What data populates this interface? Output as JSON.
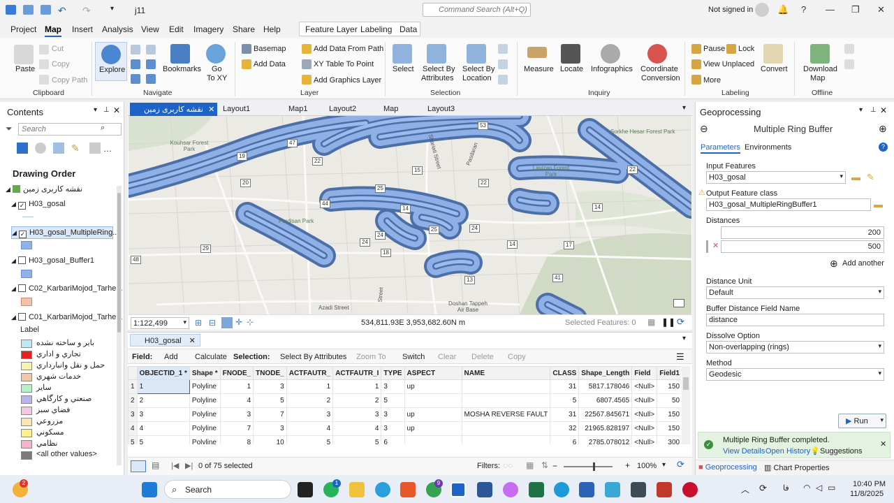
{
  "titlebar": {
    "project": "j11",
    "command_search": "Command Search (Alt+Q)",
    "user": "Not signed in",
    "help": "?"
  },
  "menu": {
    "tabs": [
      "Project",
      "Map",
      "Insert",
      "Analysis",
      "View",
      "Edit",
      "Imagery",
      "Share",
      "Help"
    ],
    "active": "Map",
    "contextual": [
      "Feature Layer",
      "Labeling",
      "Data"
    ]
  },
  "ribbon": {
    "clipboard": {
      "title": "Clipboard",
      "paste": "Paste",
      "cut": "Cut",
      "copy": "Copy",
      "copy_path": "Copy Path"
    },
    "navigate": {
      "title": "Navigate",
      "explore": "Explore",
      "bookmarks": "Bookmarks",
      "goto": "Go",
      "goto2": "To XY"
    },
    "layer": {
      "title": "Layer",
      "basemap": "Basemap",
      "add_data": "Add Data",
      "add_data_from_path": "Add Data From Path",
      "xy_table": "XY Table To Point",
      "add_graphics": "Add Graphics Layer"
    },
    "selection": {
      "title": "Selection",
      "select": "Select",
      "by_attr_1": "Select By",
      "by_attr_2": "Attributes",
      "by_loc_1": "Select By",
      "by_loc_2": "Location"
    },
    "inquiry": {
      "title": "Inquiry",
      "measure": "Measure",
      "locate": "Locate",
      "infographics": "Infographics",
      "coord_1": "Coordinate",
      "coord_2": "Conversion"
    },
    "labeling": {
      "title": "Labeling",
      "pause": "Pause",
      "lock": "Lock",
      "view_unplaced": "View Unplaced",
      "more": "More",
      "convert": "Convert"
    },
    "offline": {
      "title": "Offline",
      "download_1": "Download",
      "download_2": "Map"
    }
  },
  "contents": {
    "title": "Contents",
    "search": "Search",
    "drawing_order": "Drawing Order",
    "map_name": "نقشه کاربری زمین",
    "layers": [
      "H03_gosal",
      "H03_gosal_MultipleRing...",
      "H03_gosal_Buffer1",
      "C02_KarbariMojod_Tarhe...",
      "C01_KarbariMojod_Tarhe..."
    ],
    "label_heading": "Label",
    "legend": [
      {
        "label": "بایر و ساخته نشده",
        "color": "#bfe7f5"
      },
      {
        "label": "تجاري و اداري",
        "color": "#e8201e"
      },
      {
        "label": "حمل و نقل وانبارداري",
        "color": "#f4f3b0"
      },
      {
        "label": "خدمات شهري",
        "color": "#f3c6a9"
      },
      {
        "label": "ساير",
        "color": "#b6f0c6"
      },
      {
        "label": "صنعتي و کارگاهي",
        "color": "#b9b4ef"
      },
      {
        "label": "فضاي سبز",
        "color": "#f3c6e4"
      },
      {
        "label": "مزروعي",
        "color": "#f7e5b5"
      },
      {
        "label": "مسکوني",
        "color": "#fbf28e"
      },
      {
        "label": "نظامي",
        "color": "#f6b2c8"
      },
      {
        "label": "<all other values>",
        "color": "#7a7a7a"
      }
    ]
  },
  "views": {
    "tabs": [
      "نقشه کاربری زمین",
      "Layout1",
      "Map1",
      "Layout2",
      "Map",
      "Layout3"
    ],
    "active": "نقشه کاربری زمین"
  },
  "map": {
    "scale": "1:122,499",
    "coords": "534,811.93E 3,953,682.60N m",
    "selected": "Selected Features: 0",
    "labels": [
      "Kouhsar Forest Park",
      "Shariati Street",
      "Pasdaran",
      "Lavizan Forest Park",
      "Sorkhe Hesar Forest Park",
      "Pardisan Park",
      "Azadi Street",
      "Doshan Tappeh Air Base",
      "Street"
    ],
    "road_numbers": [
      "47",
      "19",
      "22",
      "15",
      "25",
      "44",
      "14",
      "14",
      "22",
      "24",
      "29",
      "24",
      "17",
      "48",
      "13",
      "41",
      "22",
      "14",
      "25",
      "18",
      "24",
      "53",
      "20"
    ]
  },
  "table": {
    "tab": "H03_gosal",
    "toolbar": {
      "field": "Field:",
      "add": "Add",
      "calculate": "Calculate",
      "selection": "Selection:",
      "select_by_attr": "Select By Attributes",
      "zoom_to": "Zoom To",
      "switch": "Switch",
      "clear": "Clear",
      "delete": "Delete",
      "copy": "Copy"
    },
    "columns": [
      "OBJECTID_1 *",
      "Shape *",
      "FNODE_",
      "TNODE_",
      "ACTFAUTR_",
      "ACTFAUTR_I",
      "TYPE",
      "ASPECT",
      "NAME",
      "CLASS",
      "Shape_Length",
      "Field",
      "Field1"
    ],
    "rows": [
      [
        "1",
        "1",
        "Polyline",
        "1",
        "3",
        "1",
        "1",
        "3",
        "up",
        "",
        "31",
        "5817.178046",
        "<Null>",
        "150"
      ],
      [
        "2",
        "2",
        "Polyline",
        "4",
        "5",
        "2",
        "2",
        "5",
        "",
        "",
        "5",
        "6807.4565",
        "<Null>",
        "50"
      ],
      [
        "3",
        "3",
        "Polyline",
        "3",
        "7",
        "3",
        "3",
        "3",
        "up",
        "MOSHA REVERSE FAULT",
        "31",
        "22567.845671",
        "<Null>",
        "150"
      ],
      [
        "4",
        "4",
        "Polyline",
        "7",
        "3",
        "4",
        "4",
        "3",
        "up",
        "",
        "32",
        "21965.828197",
        "<Null>",
        "150"
      ],
      [
        "5",
        "5",
        "Polyline",
        "8",
        "10",
        "5",
        "5",
        "6",
        "",
        "",
        "6",
        "2785.078012",
        "<Null>",
        "300"
      ]
    ],
    "status": "0 of 75 selected",
    "filters": "Filters:",
    "zoom": "100%"
  },
  "geoprocessing": {
    "title": "Geoprocessing",
    "tool": "Multiple Ring Buffer",
    "tab_parameters": "Parameters",
    "tab_environments": "Environments",
    "input_label": "Input Features",
    "input_value": "H03_gosal",
    "output_label": "Output Feature class",
    "output_value": "H03_gosal_MultipleRingBuffer1",
    "distances_label": "Distances",
    "distances": [
      "200",
      "500"
    ],
    "add_another": "Add another",
    "unit_label": "Distance Unit",
    "unit_value": "Default",
    "field_label": "Buffer Distance Field Name",
    "field_value": "distance",
    "dissolve_label": "Dissolve Option",
    "dissolve_value": "Non-overlapping (rings)",
    "method_label": "Method",
    "method_value": "Geodesic",
    "run": "Run",
    "msg": "Multiple Ring Buffer completed.",
    "view_details": "View Details",
    "open_history": "Open History",
    "suggestions": "Suggestions",
    "bottom_tabs": [
      "Geoprocessing",
      "Chart Properties"
    ]
  },
  "taskbar": {
    "search": "Search",
    "time": "10:40 PM",
    "date": "11/8/2025",
    "lang": "فا",
    "badge_weather": "2",
    "badge_whatsapp": "1",
    "badge_chrome": "9"
  }
}
